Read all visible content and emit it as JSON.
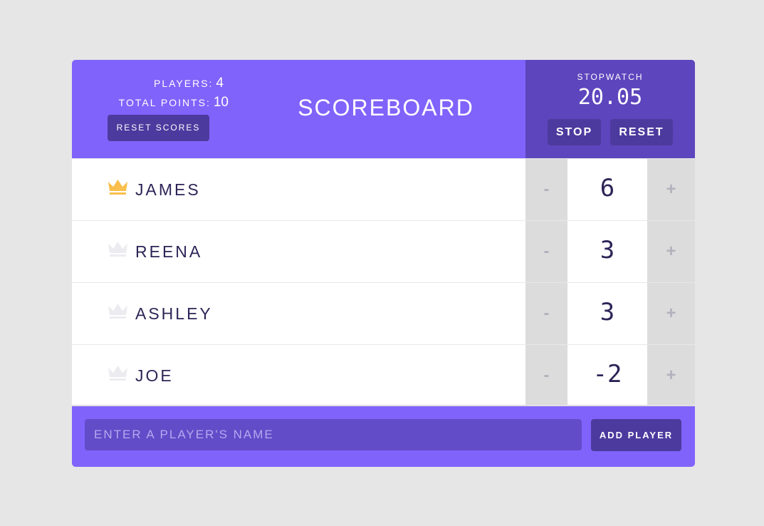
{
  "header": {
    "players_label": "PLAYERS:",
    "players_count": "4",
    "points_label": "TOTAL POINTS:",
    "points_total": "10",
    "reset_scores_label": "RESET SCORES",
    "title": "SCOREBOARD"
  },
  "stopwatch": {
    "label": "STOPWATCH",
    "time": "20.05",
    "stop_label": "STOP",
    "reset_label": "RESET"
  },
  "players": [
    {
      "name": "JAMES",
      "score": "6",
      "leader": true,
      "dec": "-",
      "inc": "+"
    },
    {
      "name": "REENA",
      "score": "3",
      "leader": false,
      "dec": "-",
      "inc": "+"
    },
    {
      "name": "ASHLEY",
      "score": "3",
      "leader": false,
      "dec": "-",
      "inc": "+"
    },
    {
      "name": "JOE",
      "score": "-2",
      "leader": false,
      "dec": "-",
      "inc": "+"
    }
  ],
  "footer": {
    "input_placeholder": "ENTER A PLAYER'S NAME",
    "input_value": "",
    "add_label": "ADD PLAYER"
  },
  "colors": {
    "accent": "#8063fb",
    "stopwatch_bg": "#5d45bd",
    "button_bg": "#4d3a9e",
    "crown_active": "#f9be4c",
    "crown_inactive": "#ececf0"
  },
  "icons": {
    "crown": "crown-icon"
  }
}
